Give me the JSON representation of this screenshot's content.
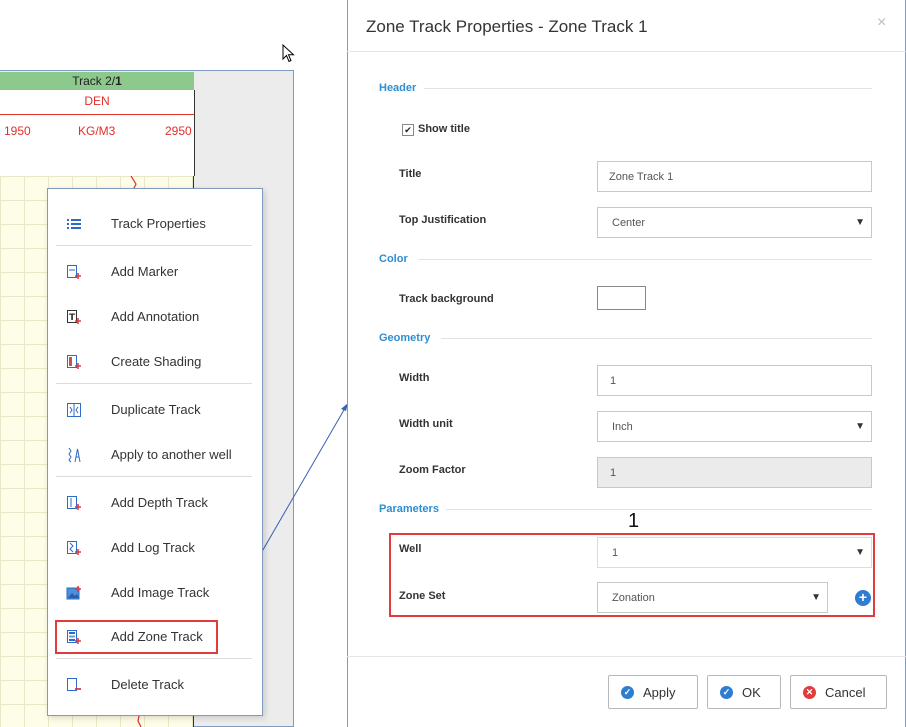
{
  "log_track": {
    "header": "Track 2/",
    "header_bold": "1",
    "curve_name": "DEN",
    "scale_left": "1950",
    "scale_unit": "KG/M3",
    "scale_right": "2950"
  },
  "context_menu": {
    "items": [
      {
        "label": "Track Properties",
        "icon": "list-icon"
      },
      {
        "label": "Add Marker",
        "icon": "add-marker-icon"
      },
      {
        "label": "Add Annotation",
        "icon": "add-annotation-icon"
      },
      {
        "label": "Create Shading",
        "icon": "create-shading-icon"
      },
      {
        "label": "Duplicate Track",
        "icon": "duplicate-track-icon"
      },
      {
        "label": "Apply to another well",
        "icon": "apply-well-icon"
      },
      {
        "label": "Add Depth Track",
        "icon": "add-depth-track-icon"
      },
      {
        "label": "Add Log Track",
        "icon": "add-log-track-icon"
      },
      {
        "label": "Add Image Track",
        "icon": "add-image-track-icon"
      },
      {
        "label": "Add Zone Track",
        "icon": "add-zone-track-icon"
      },
      {
        "label": "Delete Track",
        "icon": "delete-track-icon"
      }
    ]
  },
  "dialog": {
    "title": "Zone Track Properties - Zone Track 1",
    "close": "×",
    "sections": {
      "header": "Header",
      "color": "Color",
      "geometry": "Geometry",
      "parameters": "Parameters"
    },
    "show_title": {
      "label": "Show title",
      "checked": true,
      "mark": "✔"
    },
    "fields": {
      "title": {
        "label": "Title",
        "value": "Zone Track 1"
      },
      "top_justification": {
        "label": "Top Justification",
        "value": "Center"
      },
      "track_background": {
        "label": "Track background",
        "value": "#ffffff"
      },
      "width": {
        "label": "Width",
        "value": "1"
      },
      "width_unit": {
        "label": "Width unit",
        "value": "Inch"
      },
      "zoom_factor": {
        "label": "Zoom Factor",
        "value": "1"
      },
      "well": {
        "label": "Well",
        "value": "1"
      },
      "zone_set": {
        "label": "Zone Set",
        "value": "Zonation"
      }
    },
    "annotation_number": "1",
    "buttons": {
      "apply": "Apply",
      "ok": "OK",
      "cancel": "Cancel"
    }
  },
  "colors": {
    "accent": "#2e8ed1",
    "highlight": "#e23b3b",
    "track_header": "#8dc88d",
    "curve": "#e0302a"
  }
}
